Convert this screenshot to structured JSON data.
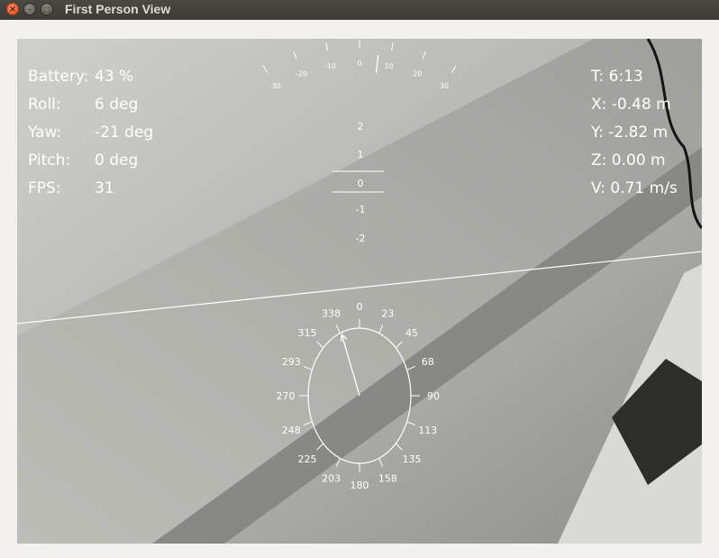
{
  "window": {
    "title": "First Person View",
    "buttons": {
      "close_icon": "×",
      "minimize_icon": "–",
      "maximize_icon": "□"
    }
  },
  "hud": {
    "left_labels": [
      "Battery:",
      "Roll:",
      "Yaw:",
      "Pitch:",
      "FPS:"
    ],
    "left_values": [
      "43 %",
      "6 deg",
      "-21 deg",
      "0 deg",
      "31"
    ],
    "right_readouts": [
      "T: 6:13",
      "X: -0.48 m",
      "Y: -2.82 m",
      "Z: 0.00 m",
      "V: 0.71 m/s"
    ],
    "roll_scale": {
      "labels": [
        "-30",
        "-20",
        "-10",
        "0",
        "10",
        "20",
        "30"
      ],
      "roll_deg": 6
    },
    "pitch_ladder": {
      "labels": [
        "2",
        "1",
        "0",
        "-1",
        "-2"
      ]
    },
    "compass": {
      "labels": [
        "0",
        "23",
        "45",
        "68",
        "90",
        "113",
        "135",
        "158",
        "180",
        "203",
        "225",
        "248",
        "270",
        "293",
        "315",
        "338"
      ],
      "heading_deg": -21
    },
    "horizon": {
      "roll_deg": 6
    }
  }
}
